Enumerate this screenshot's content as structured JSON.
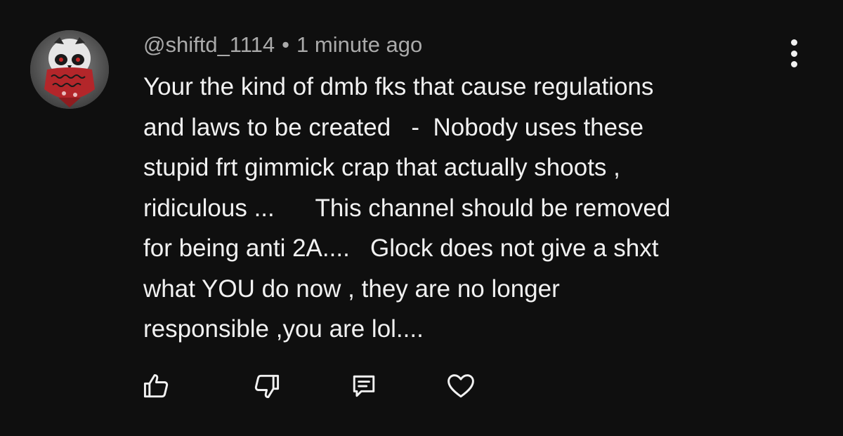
{
  "comment": {
    "handle": "@shiftd_1114",
    "separator": "•",
    "time": "1 minute ago",
    "lines": [
      "Your the kind of dmb fks that cause regulations",
      "and laws to be created   -  Nobody uses these",
      "stupid frt gimmick crap that actually shoots ,",
      "ridiculous ...      This channel should be removed",
      "for being anti 2A....   Glock does not give a shxt",
      "what YOU do now , they are no longer",
      "responsible ,you are lol...."
    ]
  },
  "actions": {
    "like_icon": "thumbs-up-icon",
    "dislike_icon": "thumbs-down-icon",
    "reply_icon": "reply-icon",
    "heart_icon": "heart-icon",
    "more_icon": "more-vertical-icon"
  },
  "colors": {
    "background": "#0f0f0f",
    "text": "#f1f1f1",
    "meta": "#aaaaaa",
    "avatar_bandana": "#b3262a"
  }
}
